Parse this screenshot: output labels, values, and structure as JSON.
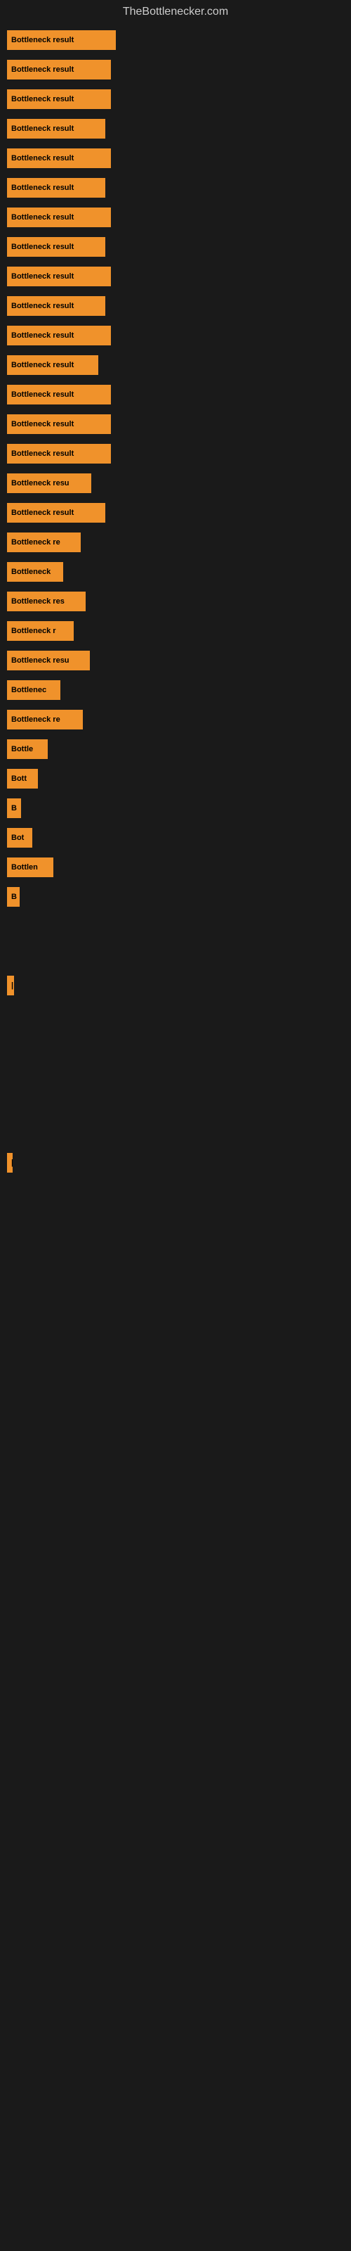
{
  "header": {
    "title": "TheBottlenecker.com"
  },
  "bars": [
    {
      "label": "Bottleneck result",
      "width": 155
    },
    {
      "label": "Bottleneck result",
      "width": 148
    },
    {
      "label": "Bottleneck result",
      "width": 148
    },
    {
      "label": "Bottleneck result",
      "width": 140
    },
    {
      "label": "Bottleneck result",
      "width": 148
    },
    {
      "label": "Bottleneck result",
      "width": 140
    },
    {
      "label": "Bottleneck result",
      "width": 148
    },
    {
      "label": "Bottleneck result",
      "width": 140
    },
    {
      "label": "Bottleneck result",
      "width": 148
    },
    {
      "label": "Bottleneck result",
      "width": 140
    },
    {
      "label": "Bottleneck result",
      "width": 148
    },
    {
      "label": "Bottleneck result",
      "width": 130
    },
    {
      "label": "Bottleneck result",
      "width": 148
    },
    {
      "label": "Bottleneck result",
      "width": 148
    },
    {
      "label": "Bottleneck result",
      "width": 148
    },
    {
      "label": "Bottleneck resu",
      "width": 120
    },
    {
      "label": "Bottleneck result",
      "width": 140
    },
    {
      "label": "Bottleneck re",
      "width": 105
    },
    {
      "label": "Bottleneck",
      "width": 80
    },
    {
      "label": "Bottleneck res",
      "width": 112
    },
    {
      "label": "Bottleneck r",
      "width": 95
    },
    {
      "label": "Bottleneck resu",
      "width": 118
    },
    {
      "label": "Bottlenec",
      "width": 76
    },
    {
      "label": "Bottleneck re",
      "width": 108
    },
    {
      "label": "Bottle",
      "width": 58
    },
    {
      "label": "Bott",
      "width": 44
    },
    {
      "label": "B",
      "width": 20
    },
    {
      "label": "Bot",
      "width": 36
    },
    {
      "label": "Bottlen",
      "width": 66
    },
    {
      "label": "B",
      "width": 18
    },
    {
      "label": "",
      "width": 0
    },
    {
      "label": "",
      "width": 0
    },
    {
      "label": "|",
      "width": 10
    },
    {
      "label": "",
      "width": 0
    },
    {
      "label": "",
      "width": 0
    },
    {
      "label": "",
      "width": 0
    },
    {
      "label": "",
      "width": 0
    },
    {
      "label": "",
      "width": 0
    },
    {
      "label": "|",
      "width": 8
    }
  ]
}
